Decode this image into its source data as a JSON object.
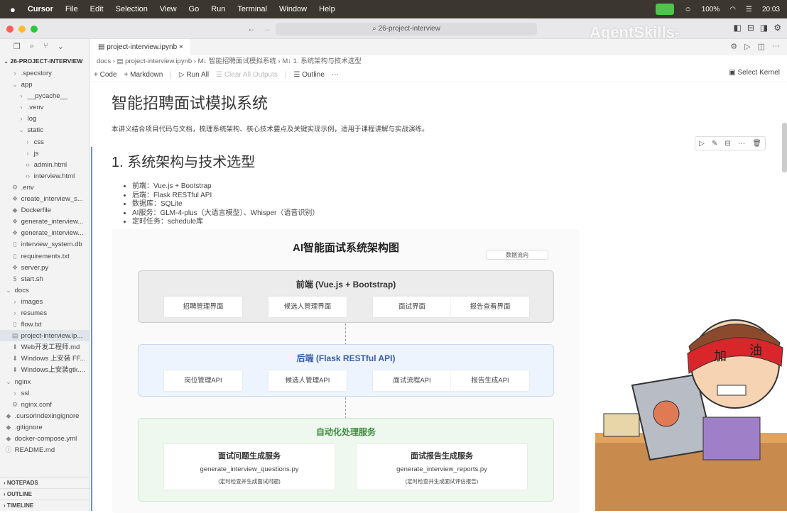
{
  "menubar": {
    "apple": "",
    "app": "Cursor",
    "items": [
      "File",
      "Edit",
      "Selection",
      "View",
      "Go",
      "Run",
      "Terminal",
      "Window",
      "Help"
    ],
    "battery": "100%",
    "time": "20:03"
  },
  "titlebar": {
    "search": "26-project-interview",
    "watermark": "AgentSkills-"
  },
  "sidebar": {
    "root": "26-PROJECT-INTERVIEW",
    "items": [
      {
        "label": ".specstory",
        "icon": "chevron-right",
        "indent": 1
      },
      {
        "label": "app",
        "icon": "chevron-down",
        "indent": 1
      },
      {
        "label": "__pycache__",
        "icon": "chevron-right",
        "indent": 2
      },
      {
        "label": ".venv",
        "icon": "chevron-right",
        "indent": 2
      },
      {
        "label": "log",
        "icon": "chevron-right",
        "indent": 2
      },
      {
        "label": "static",
        "icon": "chevron-down",
        "indent": 2
      },
      {
        "label": "css",
        "icon": "chevron-right",
        "indent": 3
      },
      {
        "label": "js",
        "icon": "chevron-right",
        "indent": 3
      },
      {
        "label": "admin.html",
        "icon": "html",
        "indent": 3
      },
      {
        "label": "interview.html",
        "icon": "html",
        "indent": 3
      },
      {
        "label": ".env",
        "icon": "gear",
        "indent": 1
      },
      {
        "label": "create_interview_s...",
        "icon": "python",
        "indent": 1
      },
      {
        "label": "Dockerfile",
        "icon": "docker",
        "indent": 1
      },
      {
        "label": "generate_interview...",
        "icon": "python",
        "indent": 1
      },
      {
        "label": "generate_interview...",
        "icon": "python",
        "indent": 1
      },
      {
        "label": "interview_system.db",
        "icon": "file",
        "indent": 1
      },
      {
        "label": "requirements.txt",
        "icon": "file",
        "indent": 1
      },
      {
        "label": "server.py",
        "icon": "python",
        "indent": 1
      },
      {
        "label": "start.sh",
        "icon": "shell",
        "indent": 1
      },
      {
        "label": "docs",
        "icon": "chevron-down",
        "indent": 0
      },
      {
        "label": "images",
        "icon": "chevron-right",
        "indent": 1
      },
      {
        "label": "resumes",
        "icon": "chevron-right",
        "indent": 1
      },
      {
        "label": "flow.txt",
        "icon": "file",
        "indent": 1
      },
      {
        "label": "project-interview.ip...",
        "icon": "notebook",
        "indent": 1,
        "selected": true
      },
      {
        "label": "Web开发工程师.md",
        "icon": "markdown",
        "indent": 1
      },
      {
        "label": "Windows 上安装 FF...",
        "icon": "markdown",
        "indent": 1
      },
      {
        "label": "Windows上安装gtk....",
        "icon": "markdown",
        "indent": 1
      },
      {
        "label": "nginx",
        "icon": "chevron-down",
        "indent": 0
      },
      {
        "label": "ssl",
        "icon": "chevron-right",
        "indent": 1
      },
      {
        "label": "nginx.conf",
        "icon": "gear",
        "indent": 1
      },
      {
        "label": ".cursorindexingignore",
        "icon": "diamond",
        "indent": 0
      },
      {
        "label": ".gitignore",
        "icon": "diamond",
        "indent": 0
      },
      {
        "label": "docker-compose.yml",
        "icon": "docker",
        "indent": 0
      },
      {
        "label": "README.md",
        "icon": "info",
        "indent": 0
      }
    ],
    "panels": [
      "NOTEPADS",
      "OUTLINE",
      "TIMELINE"
    ]
  },
  "editor": {
    "tab": "project-interview.ipynb",
    "breadcrumb": [
      "docs",
      "project-interview.ipynb",
      "M↓ 智能招聘面试模拟系统",
      "M↓ 1. 系统架构与技术选型"
    ],
    "toolbar": {
      "code": "Code",
      "markdown": "Markdown",
      "run_all": "Run All",
      "clear": "Clear All Outputs",
      "outline": "Outline",
      "more": "···"
    },
    "kernel": "Select Kernel"
  },
  "doc": {
    "title": "智能招聘面试模拟系统",
    "intro": "本讲义结合项目代码与文档，梳理系统架构、核心技术要点及关键实现示例，适用于课程讲解与实战演练。",
    "section": "1. 系统架构与技术选型",
    "bullets": [
      "前端：Vue.js + Bootstrap",
      "后端：Flask RESTful API",
      "数据库：SQLite",
      "AI服务：GLM-4-plus（大语言模型）、Whisper（语音识别）",
      "定时任务：schedule库"
    ]
  },
  "diagram": {
    "title": "AI智能面试系统架构图",
    "legend": "数据流向",
    "frontend": {
      "title": "前端 (Vue.js + Bootstrap)",
      "boxes": [
        "招聘管理界面",
        "候选人管理界面",
        "面试界面",
        "报告查看界面"
      ]
    },
    "backend": {
      "title": "后端 (Flask RESTful API)",
      "boxes": [
        "岗位管理API",
        "候选人管理API",
        "面试流程API",
        "报告生成API"
      ]
    },
    "auto": {
      "title": "自动化处理服务",
      "services": [
        {
          "name": "面试问题生成服务",
          "file": "generate_interview_questions.py",
          "desc": "(定时检查并生成面试问题)"
        },
        {
          "name": "面试报告生成服务",
          "file": "generate_interview_reports.py",
          "desc": "(定时检查并生成面试评估报告)"
        }
      ]
    }
  },
  "sticker": {
    "headband": "加 油"
  },
  "colors": {
    "menubar": "#3b362f",
    "accent": "#6c8ed0",
    "backend_title": "#3a5fa8",
    "auto_title": "#3d8a3d"
  }
}
